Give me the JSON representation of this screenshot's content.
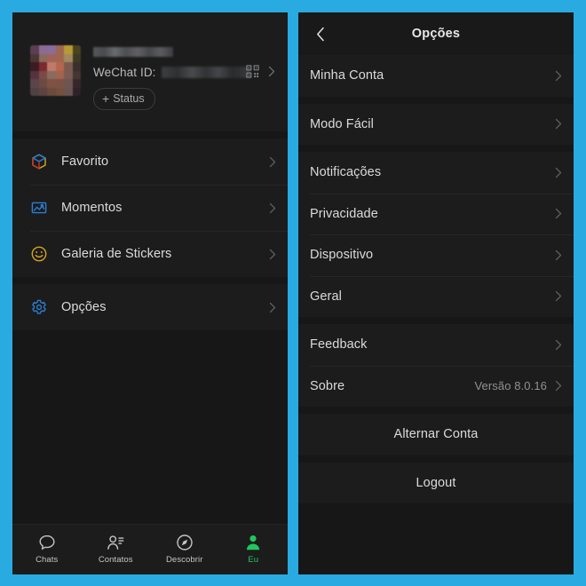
{
  "theme": {
    "page_background": "#29abe2",
    "panel_background": "#171717",
    "card_background": "#1c1c1c",
    "divider": "#262627",
    "text_primary": "#d9dbdd",
    "text_secondary": "#909294",
    "accent_green": "#22c55e",
    "icon_blue": "#2a7fd4",
    "icon_yellow": "#d9a520"
  },
  "left_panel": {
    "profile": {
      "name_redacted": true,
      "wechat_id_label": "WeChat ID:",
      "wechat_id_redacted": true,
      "status_button_label": "Status",
      "status_button_plus": "+",
      "qr_icon": "qr-code-icon",
      "chevron_icon": "chevron-right-icon"
    },
    "menu_group_1": [
      {
        "label": "Favorito",
        "icon": "cube-icon"
      },
      {
        "label": "Momentos",
        "icon": "photo-icon"
      },
      {
        "label": "Galeria de Stickers",
        "icon": "smiley-icon"
      }
    ],
    "menu_group_2": [
      {
        "label": "Opções",
        "icon": "gear-icon"
      }
    ],
    "tabbar": [
      {
        "label": "Chats",
        "icon": "chat-bubble-icon",
        "active": false
      },
      {
        "label": "Contatos",
        "icon": "contacts-icon",
        "active": false
      },
      {
        "label": "Descobrir",
        "icon": "compass-icon",
        "active": false
      },
      {
        "label": "Eu",
        "icon": "person-icon",
        "active": true
      }
    ]
  },
  "right_panel": {
    "header": {
      "title": "Opções",
      "back_icon": "chevron-left-icon"
    },
    "group_1": [
      {
        "label": "Minha Conta",
        "value": ""
      }
    ],
    "group_2": [
      {
        "label": "Modo Fácil",
        "value": ""
      }
    ],
    "group_3": [
      {
        "label": "Notificações",
        "value": ""
      },
      {
        "label": "Privacidade",
        "value": ""
      },
      {
        "label": "Dispositivo",
        "value": ""
      },
      {
        "label": "Geral",
        "value": ""
      }
    ],
    "group_4": [
      {
        "label": "Feedback",
        "value": ""
      },
      {
        "label": "Sobre",
        "value": "Versão 8.0.16"
      }
    ],
    "actions": [
      {
        "label": "Alternar Conta"
      },
      {
        "label": "Logout"
      }
    ]
  }
}
